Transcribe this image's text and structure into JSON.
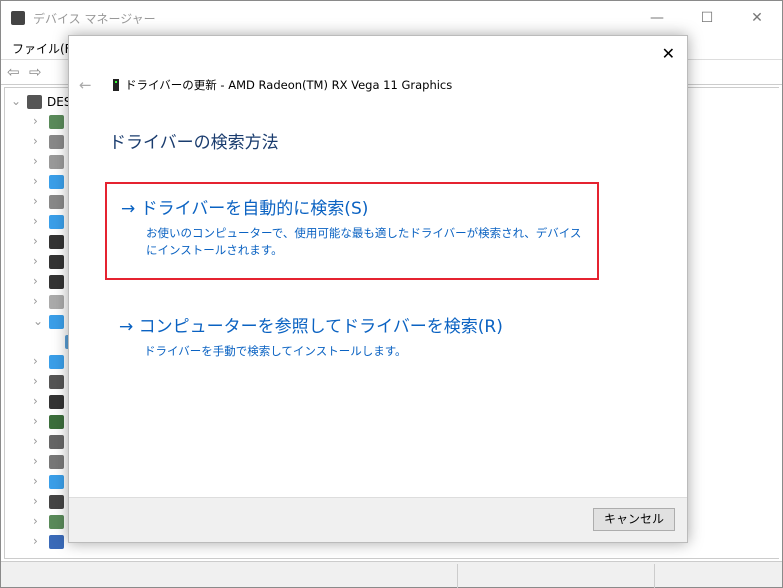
{
  "window": {
    "title": "デバイス マネージャー",
    "minimize": "—",
    "maximize": "☐",
    "close": "✕"
  },
  "menu": {
    "file": "ファイル(F)"
  },
  "tree": {
    "root": "DES",
    "icon_colors": [
      "#5a8a5a",
      "#888",
      "#999",
      "#3a9ee8",
      "#888",
      "#3a9ee8",
      "#333",
      "#333",
      "#333",
      "#aaa",
      "#3a9ee8",
      "#5aa0d8",
      "#3a9ee8",
      "#555",
      "#333",
      "#3c6e3c",
      "#666",
      "#777",
      "#3a9ee8",
      "#444",
      "#5a8a5a",
      "#3a6ab8"
    ]
  },
  "dialog": {
    "close": "✕",
    "back": "←",
    "header": "ドライバーの更新 - AMD Radeon(TM) RX Vega 11 Graphics",
    "title": "ドライバーの検索方法",
    "options": [
      {
        "title": "→ ドライバーを自動的に検索(S)",
        "desc": "お使いのコンピューターで、使用可能な最も適したドライバーが検索され、デバイスにインストールされます。"
      },
      {
        "title": "→ コンピューターを参照してドライバーを検索(R)",
        "desc": "ドライバーを手動で検索してインストールします。"
      }
    ],
    "cancel": "キャンセル"
  },
  "accent": "#0a62c2",
  "highlight": "#e52330"
}
